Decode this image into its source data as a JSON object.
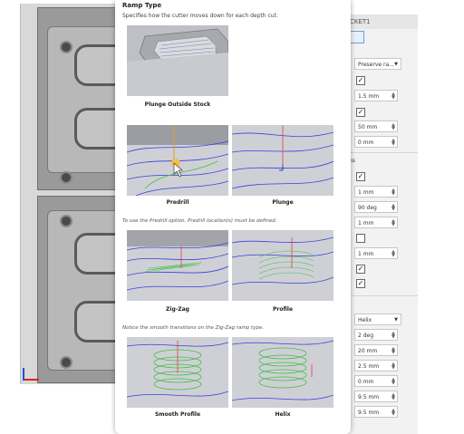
{
  "tooltip": {
    "title": "Ramp Type",
    "description": "Specifies how the cutter moves down for each depth cut.",
    "note_predrill": "To use the Predrill option, Predrill location(s) must be defined.",
    "note_smooth": "Notice the smooth transitions on the Zig-Zag ramp type.",
    "options": [
      {
        "label": "Plunge Outside Stock"
      },
      {
        "label": "Predrill"
      },
      {
        "label": "Plunge"
      },
      {
        "label": "Zig-Zag"
      },
      {
        "label": "Profile"
      },
      {
        "label": "Smooth Profile"
      },
      {
        "label": "Helix"
      }
    ]
  },
  "panel": {
    "header": "CKET1",
    "section_label_1": "ns",
    "fields": [
      {
        "kind": "dropdown",
        "value": "Preserve ra..."
      },
      {
        "kind": "checkbox",
        "checked": true
      },
      {
        "kind": "number",
        "value": "1.5 mm"
      },
      {
        "kind": "checkbox",
        "checked": true
      },
      {
        "kind": "number",
        "value": "50 mm"
      },
      {
        "kind": "number",
        "value": "0 mm"
      },
      {
        "kind": "checkbox",
        "checked": true
      },
      {
        "kind": "number",
        "value": "1 mm"
      },
      {
        "kind": "number",
        "value": "90 deg"
      },
      {
        "kind": "number",
        "value": "1 mm"
      },
      {
        "kind": "checkbox",
        "checked": false
      },
      {
        "kind": "number",
        "value": "1 mm"
      },
      {
        "kind": "checkbox",
        "checked": true
      },
      {
        "kind": "checkbox",
        "checked": true
      },
      {
        "kind": "dropdown",
        "value": "Helix"
      },
      {
        "kind": "number",
        "value": "2 deg"
      },
      {
        "kind": "number",
        "value": "20 mm"
      },
      {
        "kind": "number",
        "value": "2.5 mm"
      },
      {
        "kind": "number",
        "value": "0 mm"
      },
      {
        "kind": "number",
        "value": "9.5 mm"
      },
      {
        "kind": "number",
        "value": "9.5 mm"
      }
    ]
  },
  "colors": {
    "toolpath_blue": "#3a3fd6",
    "helix_green": "#3fbf3f",
    "tooltip_bg": "#ffffff",
    "panel_bg": "#f2f2f2"
  }
}
